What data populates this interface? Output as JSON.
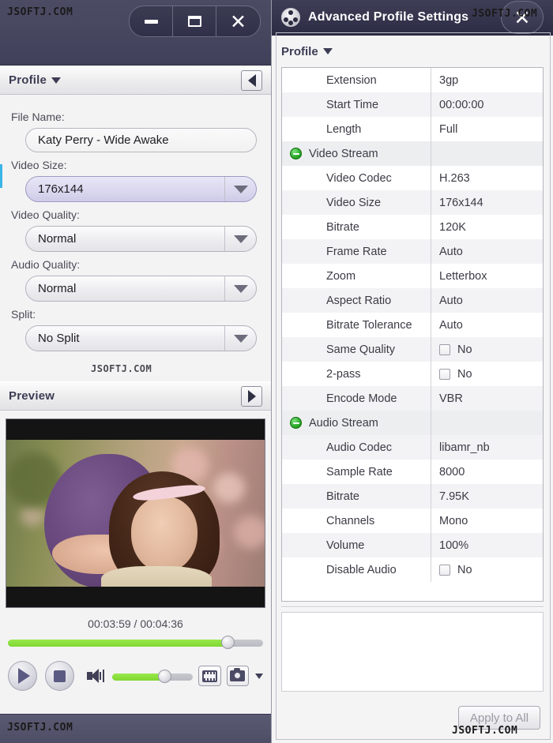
{
  "watermarks": {
    "top_left": "JSOFTJ.COM",
    "bottom_left": "JSOFTJ.COM",
    "middle": "JSOFTJ.COM",
    "top_right": "JSOFTJ.COM",
    "bottom_right": "JSOFTJ.COM"
  },
  "left_window": {
    "window_controls": {
      "minimize": "",
      "maximize": "",
      "close": "✕"
    },
    "profile_header": {
      "label": "Profile"
    },
    "fields": {
      "file_name_label": "File Name:",
      "file_name_value": "Katy Perry - Wide Awake",
      "video_size_label": "Video Size:",
      "video_size_value": "176x144",
      "video_quality_label": "Video Quality:",
      "video_quality_value": "Normal",
      "audio_quality_label": "Audio Quality:",
      "audio_quality_value": "Normal",
      "split_label": "Split:",
      "split_value": "No Split"
    },
    "preview": {
      "header_label": "Preview",
      "time_display": "00:03:59 / 00:04:36",
      "seek_percent": 86,
      "volume_percent": 65
    }
  },
  "right_window": {
    "title": "Advanced Profile Settings",
    "close_label": "✕",
    "profile_header": {
      "label": "Profile"
    },
    "properties": [
      {
        "name": "Extension",
        "value": "3gp",
        "type": "item"
      },
      {
        "name": "Start Time",
        "value": "00:00:00",
        "type": "item"
      },
      {
        "name": "Length",
        "value": "Full",
        "type": "item"
      },
      {
        "name": "Video Stream",
        "value": "",
        "type": "group"
      },
      {
        "name": "Video Codec",
        "value": "H.263",
        "type": "item"
      },
      {
        "name": "Video Size",
        "value": "176x144",
        "type": "item"
      },
      {
        "name": "Bitrate",
        "value": "120K",
        "type": "item"
      },
      {
        "name": "Frame Rate",
        "value": "Auto",
        "type": "item"
      },
      {
        "name": "Zoom",
        "value": "Letterbox",
        "type": "item"
      },
      {
        "name": "Aspect Ratio",
        "value": "Auto",
        "type": "item"
      },
      {
        "name": "Bitrate Tolerance",
        "value": "Auto",
        "type": "item"
      },
      {
        "name": "Same Quality",
        "value": "No",
        "type": "checkbox"
      },
      {
        "name": "2-pass",
        "value": "No",
        "type": "checkbox"
      },
      {
        "name": "Encode Mode",
        "value": "VBR",
        "type": "item"
      },
      {
        "name": "Audio Stream",
        "value": "",
        "type": "group"
      },
      {
        "name": "Audio Codec",
        "value": "libamr_nb",
        "type": "item"
      },
      {
        "name": "Sample Rate",
        "value": "8000",
        "type": "item"
      },
      {
        "name": "Bitrate",
        "value": "7.95K",
        "type": "item"
      },
      {
        "name": "Channels",
        "value": "Mono",
        "type": "item"
      },
      {
        "name": "Volume",
        "value": "100%",
        "type": "item"
      },
      {
        "name": "Disable Audio",
        "value": "No",
        "type": "checkbox"
      }
    ],
    "description_box": "",
    "apply_button": "Apply to All"
  },
  "colors": {
    "titlebar": "#3a3a52",
    "accent_green": "#8cdf3c",
    "accent_blue": "#3bb4e8",
    "select_focus": "#dbd8ef"
  }
}
